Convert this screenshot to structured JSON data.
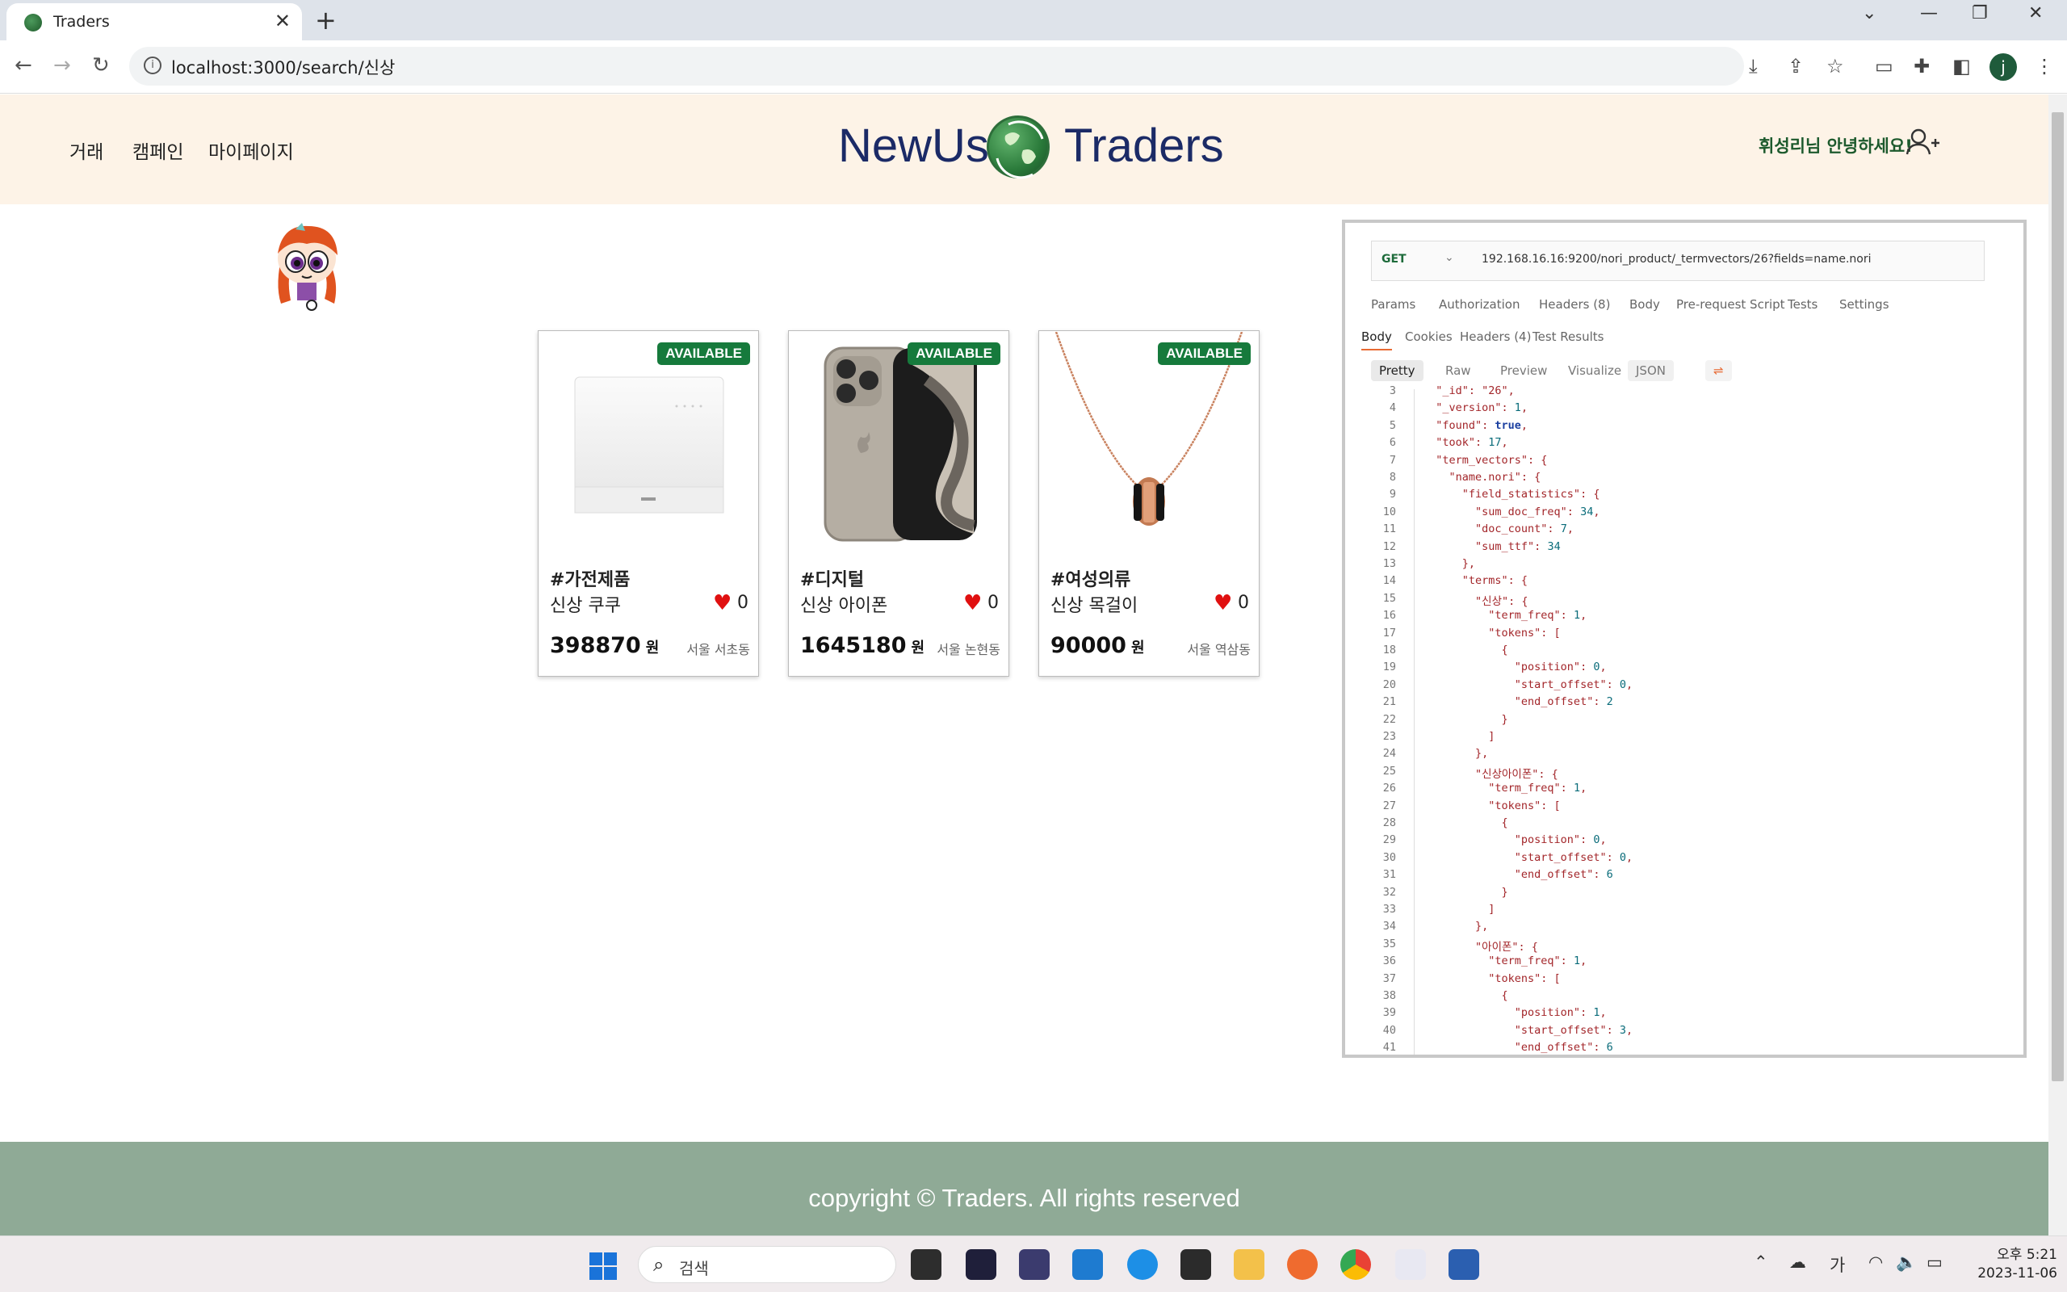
{
  "browser": {
    "tab_title": "Traders",
    "url": "localhost:3000/search/신상"
  },
  "header": {
    "menu": [
      "거래",
      "캠페인",
      "마이페이지"
    ],
    "logo_left": "NewUs",
    "logo_right": "Traders",
    "greeting": "휘성리님 안녕하세요!"
  },
  "products": [
    {
      "badge": "AVAILABLE",
      "category": "#가전제품",
      "name": "신상 쿠쿠",
      "likes": "0",
      "price": "398870",
      "currency": "원",
      "location": "서울 서초동"
    },
    {
      "badge": "AVAILABLE",
      "category": "#디지털",
      "name": "신상 아이폰",
      "likes": "0",
      "price": "1645180",
      "currency": "원",
      "location": "서울 논현동"
    },
    {
      "badge": "AVAILABLE",
      "category": "#여성의류",
      "name": "신상 목걸이",
      "likes": "0",
      "price": "90000",
      "currency": "원",
      "location": "서울 역삼동"
    }
  ],
  "postman": {
    "method": "GET",
    "url": "192.168.16.16:9200/nori_product/_termvectors/26?fields=name.nori",
    "tabs": [
      "Params",
      "Authorization",
      "Headers (8)",
      "Body",
      "Pre-request Script",
      "Tests",
      "Settings"
    ],
    "body_tabs": [
      "Body",
      "Cookies",
      "Headers (4)",
      "Test Results"
    ],
    "formats": [
      "Pretty",
      "Raw",
      "Preview",
      "Visualize",
      "JSON"
    ],
    "lines": [
      {
        "n": "3",
        "t": "  \"_id\": \"26\","
      },
      {
        "n": "4",
        "t": "  \"_version\": 1,"
      },
      {
        "n": "5",
        "t": "  \"found\": true,"
      },
      {
        "n": "6",
        "t": "  \"took\": 17,"
      },
      {
        "n": "7",
        "t": "  \"term_vectors\": {"
      },
      {
        "n": "8",
        "t": "    \"name.nori\": {"
      },
      {
        "n": "9",
        "t": "      \"field_statistics\": {"
      },
      {
        "n": "10",
        "t": "        \"sum_doc_freq\": 34,"
      },
      {
        "n": "11",
        "t": "        \"doc_count\": 7,"
      },
      {
        "n": "12",
        "t": "        \"sum_ttf\": 34"
      },
      {
        "n": "13",
        "t": "      },"
      },
      {
        "n": "14",
        "t": "      \"terms\": {"
      },
      {
        "n": "15",
        "t": "        \"신상\": {"
      },
      {
        "n": "16",
        "t": "          \"term_freq\": 1,"
      },
      {
        "n": "17",
        "t": "          \"tokens\": ["
      },
      {
        "n": "18",
        "t": "            {"
      },
      {
        "n": "19",
        "t": "              \"position\": 0,"
      },
      {
        "n": "20",
        "t": "              \"start_offset\": 0,"
      },
      {
        "n": "21",
        "t": "              \"end_offset\": 2"
      },
      {
        "n": "22",
        "t": "            }"
      },
      {
        "n": "23",
        "t": "          ]"
      },
      {
        "n": "24",
        "t": "        },"
      },
      {
        "n": "25",
        "t": "        \"신상아이폰\": {"
      },
      {
        "n": "26",
        "t": "          \"term_freq\": 1,"
      },
      {
        "n": "27",
        "t": "          \"tokens\": ["
      },
      {
        "n": "28",
        "t": "            {"
      },
      {
        "n": "29",
        "t": "              \"position\": 0,"
      },
      {
        "n": "30",
        "t": "              \"start_offset\": 0,"
      },
      {
        "n": "31",
        "t": "              \"end_offset\": 6"
      },
      {
        "n": "32",
        "t": "            }"
      },
      {
        "n": "33",
        "t": "          ]"
      },
      {
        "n": "34",
        "t": "        },"
      },
      {
        "n": "35",
        "t": "        \"아이폰\": {"
      },
      {
        "n": "36",
        "t": "          \"term_freq\": 1,"
      },
      {
        "n": "37",
        "t": "          \"tokens\": ["
      },
      {
        "n": "38",
        "t": "            {"
      },
      {
        "n": "39",
        "t": "              \"position\": 1,"
      },
      {
        "n": "40",
        "t": "              \"start_offset\": 3,"
      },
      {
        "n": "41",
        "t": "              \"end_offset\": 6"
      }
    ]
  },
  "footer": {
    "text": "copyright © Traders. All rights reserved"
  },
  "taskbar": {
    "search_label": "검색",
    "ime": "가",
    "time": "오후 5:21",
    "date": "2023-11-06"
  },
  "profile_initial": "j",
  "colors": {
    "header_bg": "#fdf3e7",
    "footer_bg": "#8faa96",
    "badge": "#167a3c",
    "logo": "#1b2a66",
    "heart": "#e01010"
  }
}
